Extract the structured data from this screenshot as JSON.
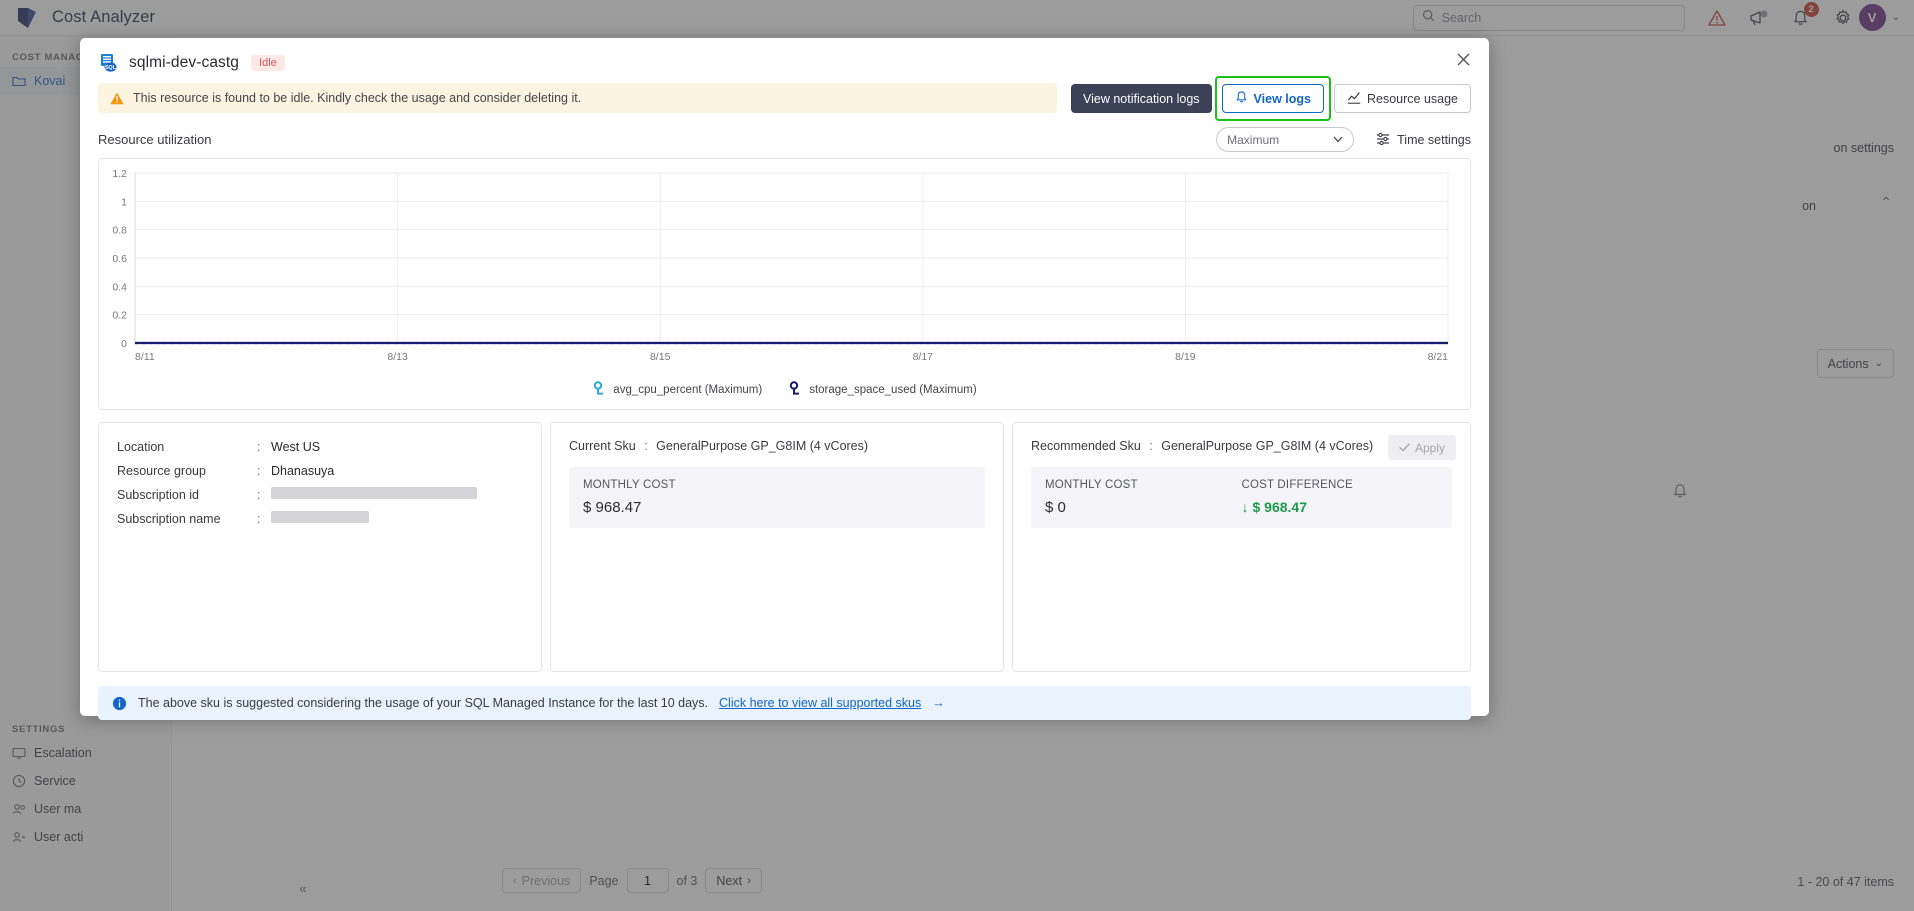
{
  "app": {
    "title": "Cost Analyzer",
    "logo_icon": "azure-logo-icon"
  },
  "topbar": {
    "search": {
      "placeholder": "Search",
      "icon": "search-icon"
    },
    "icons": [
      {
        "name": "alert-triangle-icon",
        "label": ""
      },
      {
        "name": "megaphone-icon",
        "label": ""
      },
      {
        "name": "bell-icon",
        "label": "",
        "badge": "2"
      },
      {
        "name": "gear-icon",
        "label": ""
      }
    ],
    "avatar_initial": "V",
    "avatar_chevron": "⌄"
  },
  "sidebar": {
    "section_cost": "COST MANAGE",
    "item_kovai": "Kovai",
    "section_settings": "SETTINGS",
    "items": [
      {
        "label": "Escalation",
        "icon": "monitor-icon"
      },
      {
        "label": "Service ",
        "icon": "clock-icon"
      },
      {
        "label": "User ma",
        "icon": "users-icon"
      },
      {
        "label": "User acti",
        "icon": "user-activity-icon"
      }
    ],
    "collapse_icon": "«"
  },
  "background_page": {
    "notification_settings_label": "on settings",
    "section_label": "on",
    "actions_label": "Actions",
    "chevron_down": "⌄",
    "chevron_up": "⌃",
    "bell_icon": "bell-icon",
    "pager": {
      "previous": "Previous",
      "page_label": "Page",
      "page_value": "1",
      "of_label": "of 3",
      "next": "Next"
    },
    "items_count": "1 - 20 of 47 items"
  },
  "modal": {
    "resource_icon": "sql-database-icon",
    "title": "sqlmi-dev-castg",
    "status_badge": "Idle",
    "close_icon": "close-icon",
    "banner": {
      "icon": "warning-triangle-icon",
      "text": "This resource is found to be idle. Kindly check the usage and consider deleting it."
    },
    "actions": {
      "view_notification_logs": "View notification logs",
      "view_logs": "View logs",
      "view_logs_icon": "bell-icon",
      "resource_usage": "Resource usage",
      "resource_usage_icon": "chart-icon",
      "focused_button": "view-logs-button"
    },
    "utilization": {
      "title": "Resource utilization",
      "aggregation_selected": "Maximum",
      "aggregation_chevron": "⌄",
      "time_settings": "Time settings",
      "time_settings_icon": "sliders-icon"
    },
    "details": {
      "rows": [
        {
          "key": "Location",
          "sep": ":",
          "value": "West US",
          "redacted": false
        },
        {
          "key": "Resource group",
          "sep": ":",
          "value": "Dhanasuya",
          "redacted": false
        },
        {
          "key": "Subscription id",
          "sep": ":",
          "value": "",
          "redacted": true,
          "redact_width": 206
        },
        {
          "key": "Subscription name",
          "sep": ":",
          "value": "",
          "redacted": true,
          "redact_width": 98
        }
      ]
    },
    "current_sku": {
      "label": "Current Sku",
      "sep": ":",
      "value": "GeneralPurpose  GP_G8IM (4 vCores)",
      "monthly_cost_label": "MONTHLY COST",
      "monthly_cost_value": "$ 968.47"
    },
    "recommended_sku": {
      "label": "Recommended Sku",
      "sep": ":",
      "value": "GeneralPurpose  GP_G8IM (4 vCores)",
      "monthly_cost_label": "MONTHLY COST",
      "monthly_cost_value": "$ 0",
      "cost_difference_label": "COST DIFFERENCE",
      "cost_difference_value": "$ 968.47",
      "cost_difference_arrow": "↓",
      "apply_label": "Apply",
      "apply_icon": "check-icon"
    },
    "info": {
      "icon": "info-icon",
      "text": "The above sku is suggested considering the usage of your SQL Managed Instance for the last 10 days.",
      "link": "Click here to view all supported skus",
      "link_arrow": "→"
    }
  },
  "colors": {
    "accent_blue": "#1266c9",
    "focus_green": "#19c219",
    "series_cpu": "#2eaadc",
    "series_storage": "#1b1b6e",
    "warning_bg": "#fbf4e0",
    "info_bg": "#eaf3fd",
    "idle_badge_bg": "#fde8e8",
    "idle_badge_fg": "#e05252",
    "success_green": "#1a9b4a"
  },
  "chart_data": {
    "type": "line",
    "title": "Resource utilization",
    "xlabel": "",
    "ylabel": "",
    "ylim": [
      0,
      1.2
    ],
    "yticks": [
      "1.2",
      "1",
      "0.8",
      "0.6",
      "0.4",
      "0.2",
      "0"
    ],
    "ytick_values": [
      1.2,
      1,
      0.8,
      0.6,
      0.4,
      0.2,
      0
    ],
    "xticks": [
      "8/11",
      "8/13",
      "8/15",
      "8/17",
      "8/19",
      "8/21"
    ],
    "grid": true,
    "legend_position": "bottom",
    "series": [
      {
        "name": "avg_cpu_percent (Maximum)",
        "color": "#2eaadc",
        "marker": "dotted-line",
        "x": [
          "8/11",
          "8/12",
          "8/13",
          "8/14",
          "8/15",
          "8/16",
          "8/17",
          "8/18",
          "8/19",
          "8/20",
          "8/21"
        ],
        "values": [
          0,
          0,
          0,
          0,
          0,
          0,
          0,
          0,
          0,
          0,
          0
        ]
      },
      {
        "name": "storage_space_used (Maximum)",
        "color": "#1b1b6e",
        "marker": "line",
        "x": [
          "8/11",
          "8/12",
          "8/13",
          "8/14",
          "8/15",
          "8/16",
          "8/17",
          "8/18",
          "8/19",
          "8/20",
          "8/21"
        ],
        "values": [
          0,
          0,
          0,
          0,
          0,
          0,
          0,
          0,
          0,
          0,
          0
        ]
      }
    ]
  }
}
